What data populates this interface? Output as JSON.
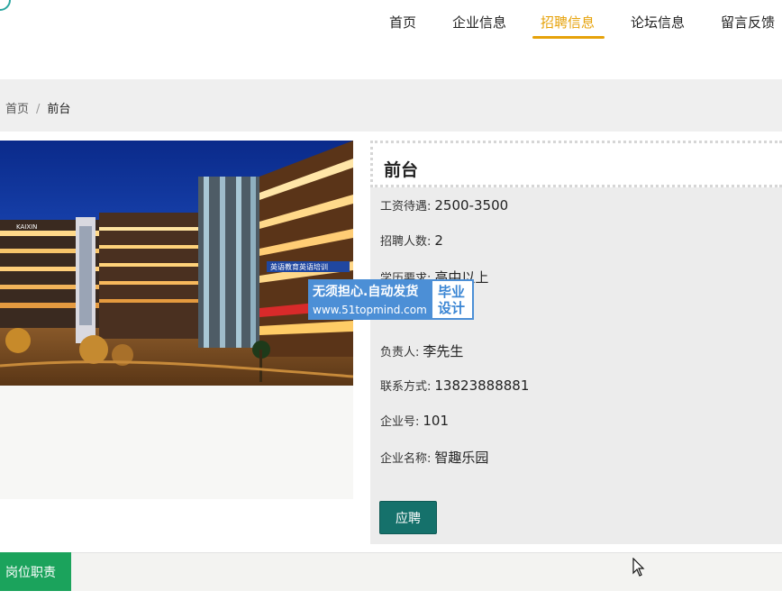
{
  "nav": {
    "items": [
      {
        "label": "首页"
      },
      {
        "label": "企业信息"
      },
      {
        "label": "招聘信息"
      },
      {
        "label": "论坛信息"
      },
      {
        "label": "留言反馈"
      }
    ],
    "active_index": 2,
    "accent_color": "#e6a20a"
  },
  "breadcrumb": {
    "home": "首页",
    "separator": "/",
    "current": "前台"
  },
  "job": {
    "title": "前台",
    "fields": [
      {
        "label": "工资待遇:",
        "value": "2500-3500"
      },
      {
        "label": "招聘人数:",
        "value": "2"
      },
      {
        "label": "学历要求:",
        "value": "高中以上"
      },
      {
        "label": "负责人:",
        "value": "李先生"
      },
      {
        "label": "联系方式:",
        "value": "13823888881"
      },
      {
        "label": "企业号:",
        "value": "101"
      },
      {
        "label": "企业名称:",
        "value": "智趣乐园"
      }
    ],
    "apply_label": "应聘",
    "apply_color": "#15716b"
  },
  "watermark": {
    "line1": "无须担心.自动发货",
    "line2": "www.51topmind.com",
    "badge_line1": "毕业",
    "badge_line2": "设计"
  },
  "bottom_tab": {
    "label": "岗位职责",
    "color": "#1ba35c"
  },
  "photo": {
    "signs": [
      "KAIXIN",
      "英语教育英语培训"
    ]
  }
}
